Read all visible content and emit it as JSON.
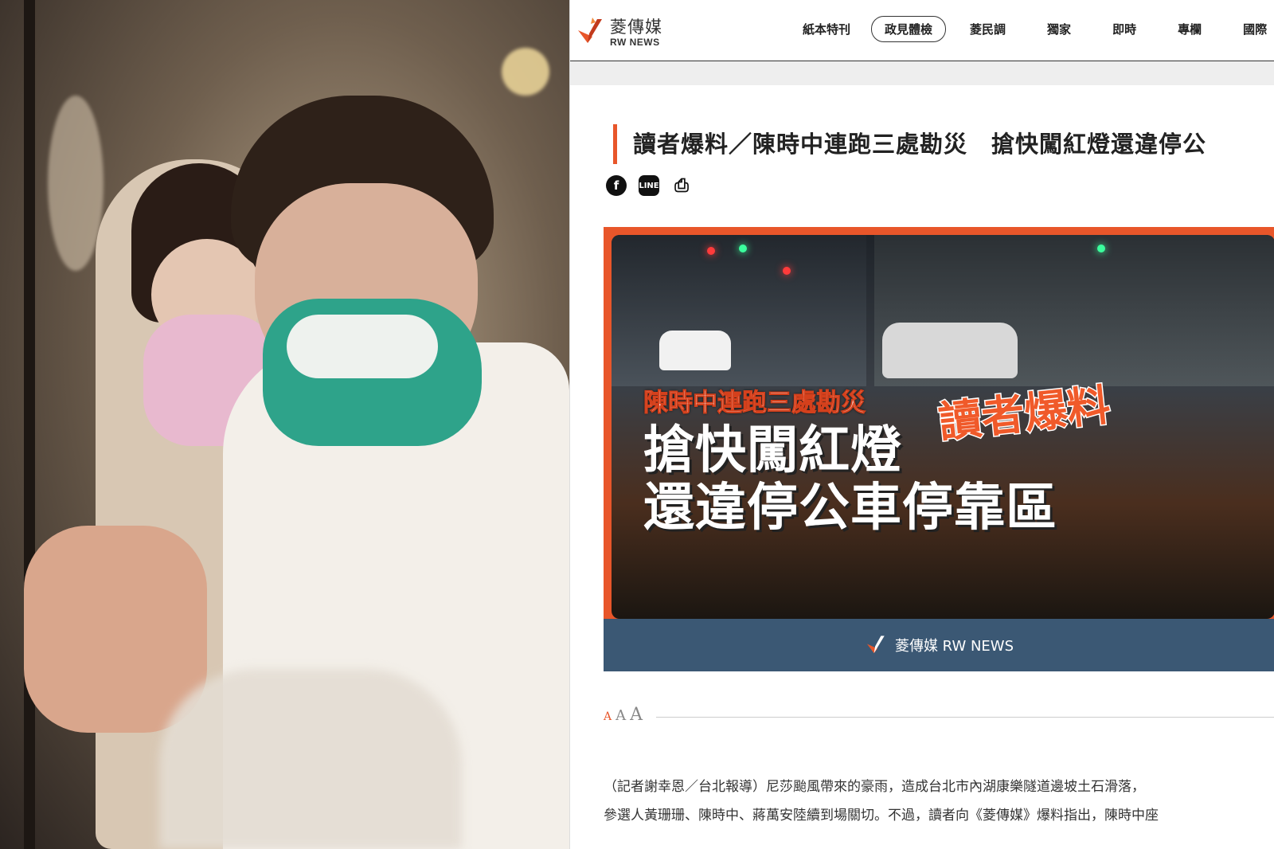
{
  "site": {
    "logo_cn": "菱傳媒",
    "logo_en": "RW NEWS"
  },
  "nav": {
    "items": [
      "紙本特刊",
      "政見體檢",
      "菱民調",
      "獨家",
      "即時",
      "專欄",
      "國際"
    ],
    "active_index": 1
  },
  "article": {
    "title": "讀者爆料／陳時中連跑三處勘災　搶快闖紅燈還違停公",
    "share": {
      "facebook_icon": "facebook-icon",
      "line_icon": "line-icon",
      "print_icon": "print-icon"
    },
    "hero": {
      "caption_small": "陳時中連跑三處勘災",
      "caption_tag": "讀者爆料",
      "caption_big_line1": "搶快闖紅燈",
      "caption_big_line2": "還違停公車停靠區",
      "footer_brand": "菱傳媒 RW NEWS"
    },
    "font_size_labels": [
      "A",
      "A",
      "A"
    ],
    "paragraph_lines": [
      "（記者謝幸恩／台北報導）尼莎颱風帶來的豪雨，造成台北市內湖康樂隧道邊坡土石滑落，",
      "參選人黃珊珊、陳時中、蔣萬安陸續到場關切。不過，讀者向《菱傳媒》爆料指出，陳時中座"
    ]
  },
  "colors": {
    "accent": "#e8562a",
    "hero_bar": "#3b5874"
  }
}
